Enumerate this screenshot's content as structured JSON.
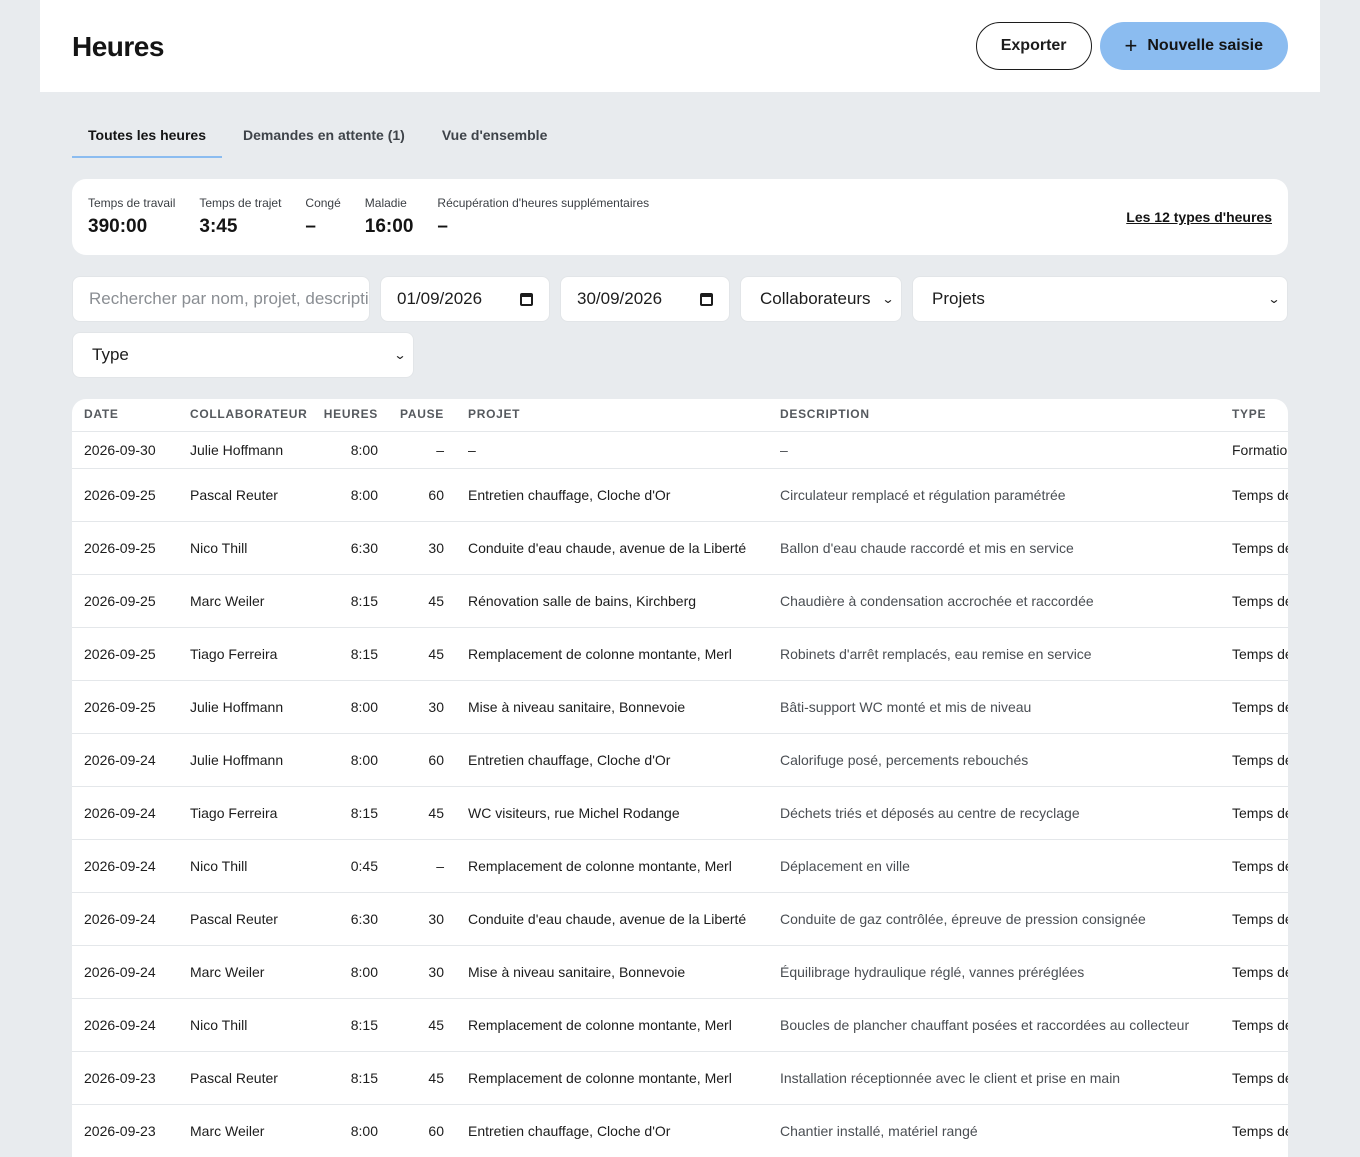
{
  "header": {
    "title": "Heures",
    "export_label": "Exporter",
    "new_label": "Nouvelle saisie"
  },
  "tabs": [
    {
      "label": "Toutes les heures",
      "active": true
    },
    {
      "label": "Demandes en attente (1)",
      "active": false
    },
    {
      "label": "Vue d'ensemble",
      "active": false
    }
  ],
  "summary": {
    "stats": [
      {
        "label": "Temps de travail",
        "value": "390:00"
      },
      {
        "label": "Temps de trajet",
        "value": "3:45"
      },
      {
        "label": "Congé",
        "value": "–"
      },
      {
        "label": "Maladie",
        "value": "16:00"
      },
      {
        "label": "Récupération d'heures supplémentaires",
        "value": "–"
      }
    ],
    "types_link": "Les 12 types d'heures"
  },
  "filters": {
    "search_placeholder": "Rechercher par nom, projet, description",
    "date_from": "01/09/2026",
    "date_to": "30/09/2026",
    "collaborators": "Collaborateurs",
    "projects": "Projets",
    "type": "Type"
  },
  "table": {
    "columns": [
      "DATE",
      "COLLABORATEUR",
      "HEURES",
      "PAUSE",
      "PROJET",
      "DESCRIPTION",
      "TYPE"
    ],
    "rows": [
      {
        "date": "2026-09-30",
        "collaborator": "Julie Hoffmann",
        "hours": "8:00",
        "pause": "–",
        "project": "–",
        "description": "–",
        "type": "Formation"
      },
      {
        "date": "2026-09-25",
        "collaborator": "Pascal Reuter",
        "hours": "8:00",
        "pause": "60",
        "project": "Entretien chauffage, Cloche d'Or",
        "description": "Circulateur remplacé et régulation paramétrée",
        "type": "Temps de travail"
      },
      {
        "date": "2026-09-25",
        "collaborator": "Nico Thill",
        "hours": "6:30",
        "pause": "30",
        "project": "Conduite d'eau chaude, avenue de la Liberté",
        "description": "Ballon d'eau chaude raccordé et mis en service",
        "type": "Temps de travail"
      },
      {
        "date": "2026-09-25",
        "collaborator": "Marc Weiler",
        "hours": "8:15",
        "pause": "45",
        "project": "Rénovation salle de bains, Kirchberg",
        "description": "Chaudière à condensation accrochée et raccordée",
        "type": "Temps de travail"
      },
      {
        "date": "2026-09-25",
        "collaborator": "Tiago Ferreira",
        "hours": "8:15",
        "pause": "45",
        "project": "Remplacement de colonne montante, Merl",
        "description": "Robinets d'arrêt remplacés, eau remise en service",
        "type": "Temps de travail"
      },
      {
        "date": "2026-09-25",
        "collaborator": "Julie Hoffmann",
        "hours": "8:00",
        "pause": "30",
        "project": "Mise à niveau sanitaire, Bonnevoie",
        "description": "Bâti-support WC monté et mis de niveau",
        "type": "Temps de travail"
      },
      {
        "date": "2026-09-24",
        "collaborator": "Julie Hoffmann",
        "hours": "8:00",
        "pause": "60",
        "project": "Entretien chauffage, Cloche d'Or",
        "description": "Calorifuge posé, percements rebouchés",
        "type": "Temps de travail"
      },
      {
        "date": "2026-09-24",
        "collaborator": "Tiago Ferreira",
        "hours": "8:15",
        "pause": "45",
        "project": "WC visiteurs, rue Michel Rodange",
        "description": "Déchets triés et déposés au centre de recyclage",
        "type": "Temps de travail"
      },
      {
        "date": "2026-09-24",
        "collaborator": "Nico Thill",
        "hours": "0:45",
        "pause": "–",
        "project": "Remplacement de colonne montante, Merl",
        "description": "Déplacement en ville",
        "type": "Temps de trajet"
      },
      {
        "date": "2026-09-24",
        "collaborator": "Pascal Reuter",
        "hours": "6:30",
        "pause": "30",
        "project": "Conduite d'eau chaude, avenue de la Liberté",
        "description": "Conduite de gaz contrôlée, épreuve de pression consignée",
        "type": "Temps de travail"
      },
      {
        "date": "2026-09-24",
        "collaborator": "Marc Weiler",
        "hours": "8:00",
        "pause": "30",
        "project": "Mise à niveau sanitaire, Bonnevoie",
        "description": "Équilibrage hydraulique réglé, vannes préréglées",
        "type": "Temps de travail"
      },
      {
        "date": "2026-09-24",
        "collaborator": "Nico Thill",
        "hours": "8:15",
        "pause": "45",
        "project": "Remplacement de colonne montante, Merl",
        "description": "Boucles de plancher chauffant posées et raccordées au collecteur",
        "type": "Temps de travail"
      },
      {
        "date": "2026-09-23",
        "collaborator": "Pascal Reuter",
        "hours": "8:15",
        "pause": "45",
        "project": "Remplacement de colonne montante, Merl",
        "description": "Installation réceptionnée avec le client et prise en main",
        "type": "Temps de travail"
      },
      {
        "date": "2026-09-23",
        "collaborator": "Marc Weiler",
        "hours": "8:00",
        "pause": "60",
        "project": "Entretien chauffage, Cloche d'Or",
        "description": "Chantier installé, matériel rangé",
        "type": "Temps de travail"
      }
    ]
  },
  "colors": {
    "primary": "#8bbcf0",
    "background": "#e8ebee"
  }
}
